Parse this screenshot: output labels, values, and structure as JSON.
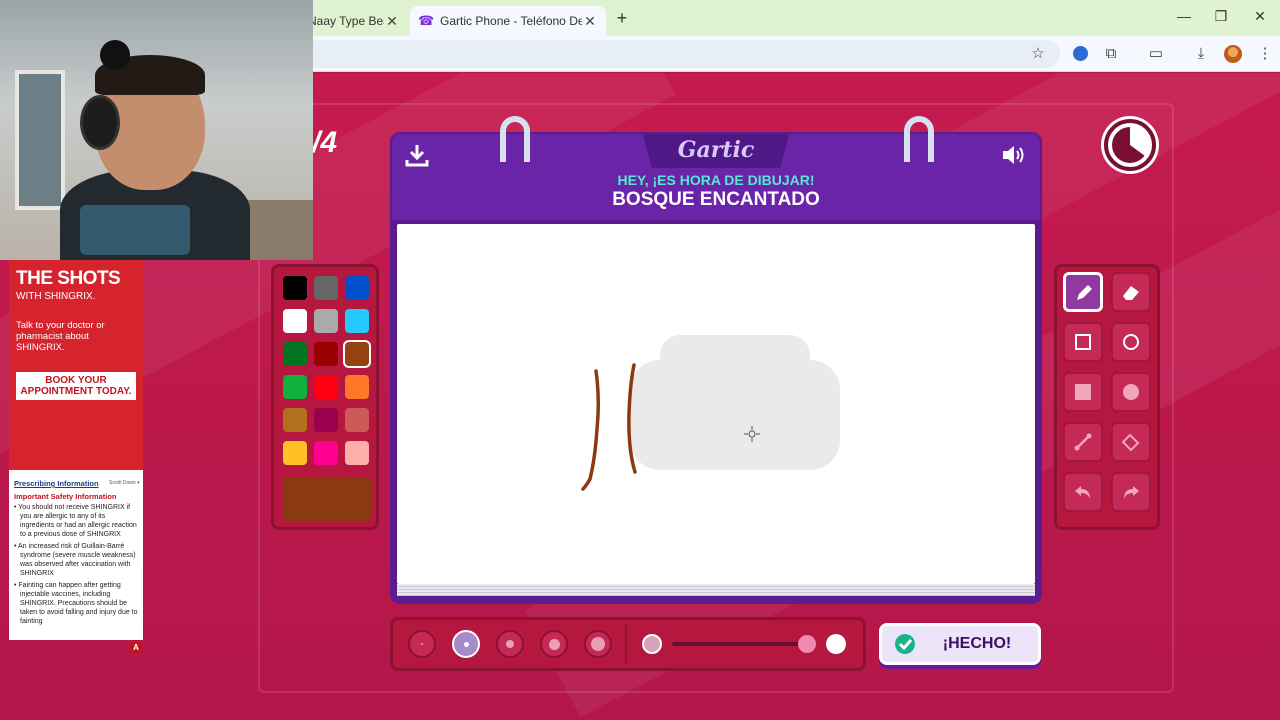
{
  "browser": {
    "tabs": [
      {
        "title": "Naay Type Beat",
        "active": false
      },
      {
        "title": "Gartic Phone - Teléfono Descompuesto",
        "active": true
      }
    ],
    "close_glyph": "✕",
    "new_tab_glyph": "+"
  },
  "game": {
    "round": "/4",
    "logo": "Gartic",
    "prompt_heading": "HEY, ¡ES HORA DE DIBUJAR!",
    "prompt_word": "BOSQUE ENCANTADO",
    "done_label": "¡HECHO!",
    "timer_remaining_fraction": 0.65,
    "palette": [
      {
        "color": "#000000"
      },
      {
        "color": "#666666"
      },
      {
        "color": "#0050cd"
      },
      {
        "color": "#ffffff"
      },
      {
        "color": "#aaaaaa"
      },
      {
        "color": "#26c9ff"
      },
      {
        "color": "#017420"
      },
      {
        "color": "#990000"
      },
      {
        "color": "#964112",
        "selected": true
      },
      {
        "color": "#11b03c"
      },
      {
        "color": "#ff0013"
      },
      {
        "color": "#ff7829"
      },
      {
        "color": "#b0701c"
      },
      {
        "color": "#99004e"
      },
      {
        "color": "#cb5a57"
      },
      {
        "color": "#ffc126"
      },
      {
        "color": "#ff008f"
      },
      {
        "color": "#feafa8"
      }
    ],
    "selected_color": "#8b3a10",
    "tools": [
      "pencil-icon",
      "eraser-icon",
      "rectangle-outline-icon",
      "circle-outline-icon",
      "rectangle-filled-icon",
      "circle-filled-icon",
      "line-icon",
      "fill-bucket-icon",
      "undo-icon",
      "redo-icon"
    ],
    "active_tool": "pencil-icon",
    "brush_sizes": 5,
    "active_brush_size_index": 1
  },
  "ad": {
    "headline": "THE SHOTS",
    "subline": "WITH SHINGRIX.",
    "body": "Talk to your doctor or pharmacist about SHINGRIX.",
    "cta": "BOOK YOUR APPOINTMENT TODAY.",
    "prescribing_link": "Prescribing Information",
    "scroll_hint": "Scroll Down ▾",
    "safety_title": "Important Safety Information",
    "bullets": [
      "• You should not receive SHINGRIX if you are allergic to any of its ingredients or had an allergic reaction to a previous dose of SHINGRIX",
      "• An increased risk of Guillain-Barré syndrome (severe muscle weakness) was observed after vaccination with SHINGRIX",
      "• Fainting can happen after getting injectable vaccines, including SHINGRIX. Precautions should be taken to avoid falling and injury due to fainting"
    ],
    "badge": "A"
  }
}
